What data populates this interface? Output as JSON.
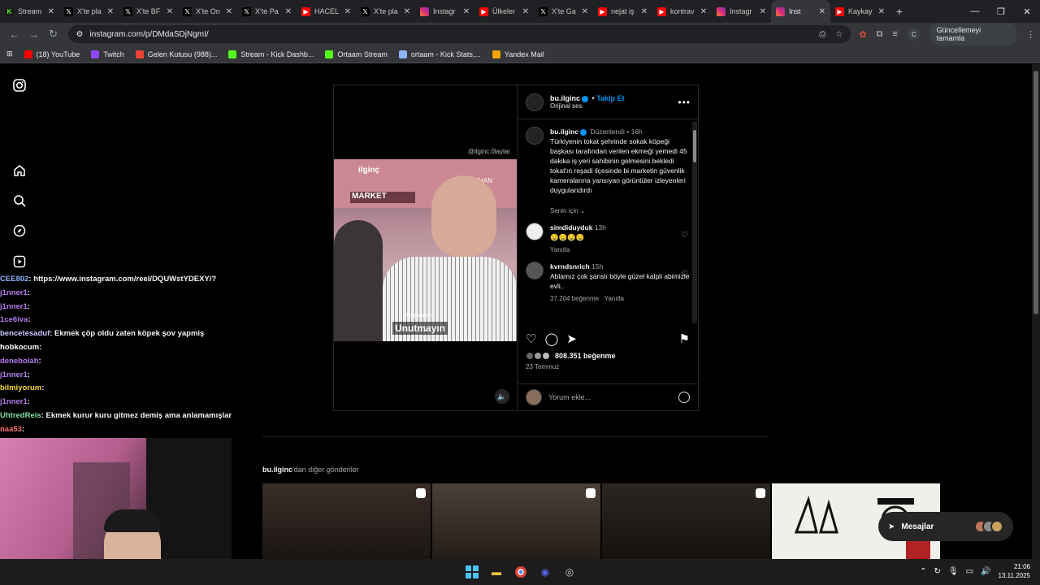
{
  "browser": {
    "tabs": [
      {
        "label": "Stream",
        "icon": "kick"
      },
      {
        "label": "X'te pla",
        "icon": "x"
      },
      {
        "label": "X'te BF",
        "icon": "x"
      },
      {
        "label": "X'te On",
        "icon": "x"
      },
      {
        "label": "X'te Pa",
        "icon": "x"
      },
      {
        "label": "HACEL",
        "icon": "youtube"
      },
      {
        "label": "X'te pla",
        "icon": "x"
      },
      {
        "label": "Instagr",
        "icon": "instagram"
      },
      {
        "label": "Ülkeler",
        "icon": "youtube"
      },
      {
        "label": "X'te Ga",
        "icon": "x"
      },
      {
        "label": "nejat iş",
        "icon": "youtube"
      },
      {
        "label": "kontrav",
        "icon": "youtube"
      },
      {
        "label": "Instagr",
        "icon": "instagram"
      },
      {
        "label": "Inst",
        "icon": "instagram"
      },
      {
        "label": "Kaykay",
        "icon": "youtube"
      }
    ],
    "active_tab_index": 13,
    "url": "instagram.com/p/DMdaSDjNgmI/",
    "profile_initial": "C",
    "update_label": "Güncellemeyi tamamla",
    "bookmarks": [
      {
        "label": "(18) YouTube",
        "icon": "youtube"
      },
      {
        "label": "Twitch",
        "icon": "twitch"
      },
      {
        "label": "Gelen Kutusu (988)...",
        "icon": "gmail"
      },
      {
        "label": "Stream - Kick Dashb...",
        "icon": "kick"
      },
      {
        "label": "Ortaam Stream",
        "icon": "kick"
      },
      {
        "label": "ortaam - Kick Stats,...",
        "icon": "stats"
      },
      {
        "label": "Yandex Mail",
        "icon": "mail"
      }
    ]
  },
  "post": {
    "author": "bu.ilginc",
    "follow_label": "Takip Et",
    "audio": "Orijinal ses",
    "edited": "Düzenlendi",
    "age": "16h",
    "caption": "Türkiyenin tokat şehrinde sokak köpeği başkası tarafından verilen ekmeği yemedi 45 dakika iş yeri sahibinin gelmesini bekledi tokat'ın reşadi ilçesinde bi marketin güvenlik kameralarına yansıyan görüntüler izleyenleri duygulandırdı",
    "translation_label": "Senin için",
    "video_watermark": "@ilginc.0laylar",
    "video_brand": "ilginç",
    "video_sign_1": "MARKET",
    "video_sign_2": "AYHAN",
    "video_small_caption": "Takip etmeyi",
    "video_caption": "Unutmayın",
    "comments": [
      {
        "user": "simdiduyduk",
        "age": "13h",
        "text": "🤤🤤🤤🤤",
        "reply": "Yanıtla"
      },
      {
        "user": "kvrndsnrich",
        "age": "15h",
        "text": "Ablamız çok şanslı böyle güzel kalpli abimizle evli..",
        "likes": "37.204 beğenme",
        "reply": "Yanıtla"
      }
    ],
    "likes": "808.351 beğenme",
    "date": "23 Temmuz",
    "comment_placeholder": "Yorum ekle..."
  },
  "more_posts": {
    "user": "bu.ilginc",
    "suffix": "'dan diğer gönderiler"
  },
  "messages_label": "Mesajlar",
  "chat": [
    {
      "user": "CEE802",
      "color": "#8fb4ff",
      "msg": ": https://www.instagram.com/reel/DQUWstYDEXY/?"
    },
    {
      "user": "j1nner1",
      "color": "#b67cf0",
      "msg": ": "
    },
    {
      "user": "j1nner1",
      "color": "#b67cf0",
      "msg": ": "
    },
    {
      "user": "1ce6iva",
      "color": "#b67cf0",
      "msg": ": "
    },
    {
      "user": "bencetesaduf",
      "color": "#c9c9ff",
      "msg": ": Ekmek çöp oldu zaten köpek şov yapmiş"
    },
    {
      "user": "hobkocum",
      "color": "#ffffff",
      "msg": ": "
    },
    {
      "user": "denebolah",
      "color": "#b67cf0",
      "msg": ": "
    },
    {
      "user": "j1nner1",
      "color": "#b67cf0",
      "msg": ": "
    },
    {
      "user": "bilmiyorum",
      "color": "#f5d742",
      "msg": ": "
    },
    {
      "user": "j1nner1",
      "color": "#b67cf0",
      "msg": ": "
    },
    {
      "user": "UhtredReis",
      "color": "#7fe0a0",
      "msg": ": Ekmek kurur kuru gitmez demiş ama anlamamışlar"
    },
    {
      "user": "naa53",
      "color": "#ff6b6b",
      "msg": ": "
    }
  ],
  "clock": {
    "time": "21:06",
    "date": "13.11.2025"
  }
}
